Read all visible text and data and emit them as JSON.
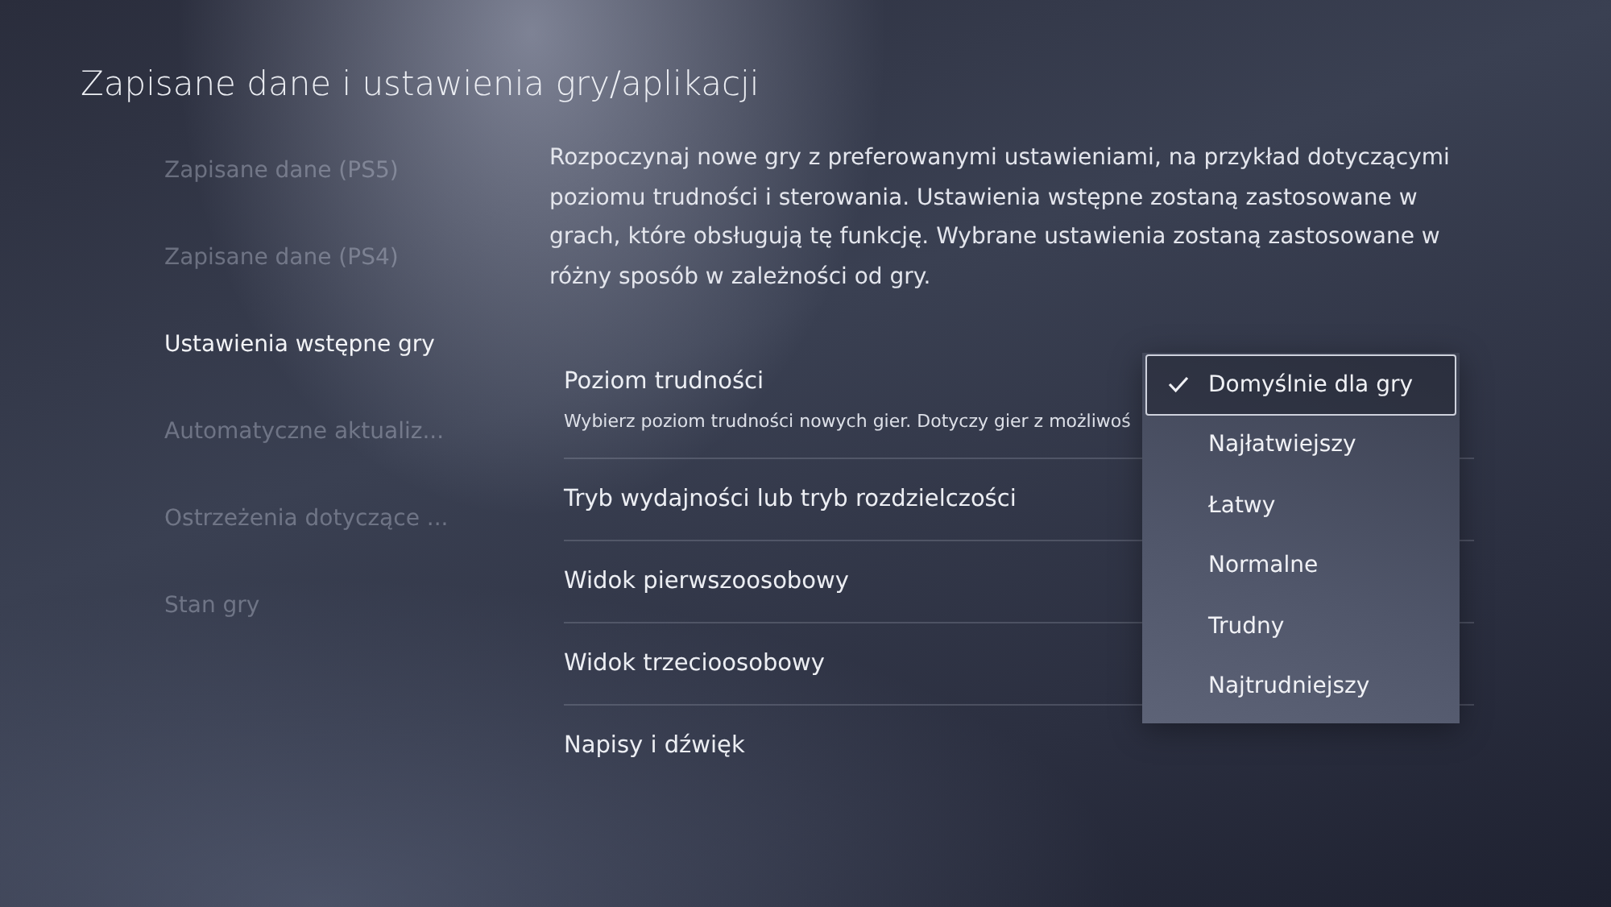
{
  "title": "Zapisane dane i ustawienia gry/aplikacji",
  "sidebar": {
    "items": [
      {
        "label": "Zapisane dane (PS5)",
        "selected": false
      },
      {
        "label": "Zapisane dane (PS4)",
        "selected": false
      },
      {
        "label": "Ustawienia wstępne gry",
        "selected": true
      },
      {
        "label": "Automatyczne aktualiz...",
        "selected": false
      },
      {
        "label": "Ostrzeżenia dotyczące ...",
        "selected": false
      },
      {
        "label": "Stan gry",
        "selected": false
      }
    ]
  },
  "description": "Rozpoczynaj nowe gry z preferowanymi ustawieniami, na przykład dotyczącymi poziomu trudności i sterowania. Ustawienia wstępne zostaną zastosowane w grach, które obsługują tę funkcję. Wybrane ustawienia zostaną zastosowane w różny sposób w zależności od gry.",
  "settings": [
    {
      "label": "Poziom trudności",
      "hint": "Wybierz poziom trudności nowych gier. Dotyczy gier z możliwoś"
    },
    {
      "label": "Tryb wydajności lub tryb rozdzielczości"
    },
    {
      "label": "Widok pierwszoosobowy"
    },
    {
      "label": "Widok trzecioosobowy"
    },
    {
      "label": "Napisy i dźwięk"
    }
  ],
  "dropdown": {
    "options": [
      {
        "label": "Domyślnie dla gry",
        "selected": true
      },
      {
        "label": "Najłatwiejszy",
        "selected": false
      },
      {
        "label": "Łatwy",
        "selected": false
      },
      {
        "label": "Normalne",
        "selected": false
      },
      {
        "label": "Trudny",
        "selected": false
      },
      {
        "label": "Najtrudniejszy",
        "selected": false
      }
    ]
  }
}
